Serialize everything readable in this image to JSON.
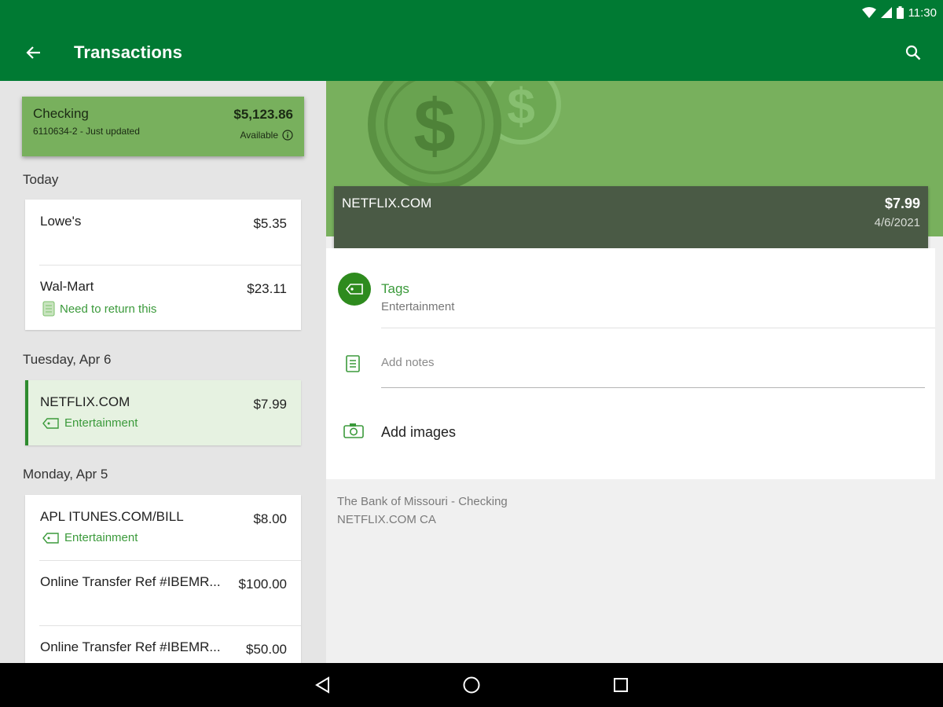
{
  "status_bar": {
    "time": "11:30"
  },
  "app_bar": {
    "title": "Transactions"
  },
  "account": {
    "name": "Checking",
    "sub": "6110634-2 - Just updated",
    "balance": "$5,123.86",
    "available_label": "Available"
  },
  "groups": [
    {
      "label": "Today",
      "transactions": [
        {
          "name": "Lowe's",
          "amount": "$5.35"
        },
        {
          "name": "Wal-Mart",
          "amount": "$23.11",
          "note": "Need to return this"
        }
      ]
    },
    {
      "label": "Tuesday, Apr 6",
      "transactions": [
        {
          "name": "NETFLIX.COM",
          "amount": "$7.99",
          "tag": "Entertainment"
        }
      ]
    },
    {
      "label": "Monday, Apr 5",
      "transactions": [
        {
          "name": "APL ITUNES.COM/BILL",
          "amount": "$8.00",
          "tag": "Entertainment"
        },
        {
          "name": "Online Transfer Ref #IBEMR...",
          "amount": "$100.00"
        },
        {
          "name": "Online Transfer Ref #IBEMR...",
          "amount": "$50.00"
        }
      ]
    }
  ],
  "detail": {
    "name": "NETFLIX.COM",
    "amount": "$7.99",
    "date": "4/6/2021",
    "tags_title": "Tags",
    "tags_value": "Entertainment",
    "notes_placeholder": "Add notes",
    "images_label": "Add images",
    "source_line1": "The Bank of Missouri - Checking",
    "source_line2": "NETFLIX.COM CA"
  },
  "colors": {
    "app_bar": "#007a33",
    "account_card": "#78b05d",
    "accent_text": "#3b9a3b",
    "selected_row": "#e6f2e1",
    "detail_card": "#4a5a45"
  },
  "icons": [
    "wifi-icon",
    "signal-icon",
    "battery-icon",
    "back-arrow-icon",
    "search-icon",
    "info-icon",
    "notes-icon",
    "tag-icon",
    "camera-icon",
    "nav-back-icon",
    "nav-home-icon",
    "nav-recents-icon"
  ]
}
